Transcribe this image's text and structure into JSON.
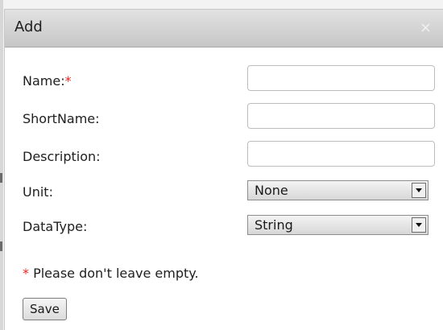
{
  "dialog": {
    "title": "Add",
    "close_glyph": "×"
  },
  "form": {
    "fields": [
      {
        "label": "Name:",
        "required_marker": "*",
        "value": ""
      },
      {
        "label": "ShortName:",
        "value": ""
      },
      {
        "label": "Description:",
        "value": ""
      }
    ],
    "unit": {
      "label": "Unit:",
      "selected": "None"
    },
    "datatype": {
      "label": "DataType:",
      "selected": "String"
    },
    "note": {
      "marker": "*",
      "text": " Please don't leave empty."
    },
    "save_label": "Save"
  }
}
